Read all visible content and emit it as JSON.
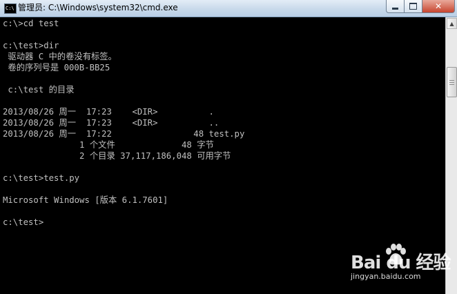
{
  "window": {
    "title": "管理员: C:\\Windows\\system32\\cmd.exe",
    "icon_label": "C:\\",
    "minimize_icon": "minimize-icon",
    "maximize_icon": "maximize-icon",
    "close_icon": "close-icon",
    "close_glyph": "✕"
  },
  "console": {
    "lines": [
      "c:\\>cd test",
      "",
      "c:\\test>dir",
      " 驱动器 C 中的卷没有标签。",
      " 卷的序列号是 000B-BB25",
      "",
      " c:\\test 的目录",
      "",
      "2013/08/26 周一  17:23    <DIR>          .",
      "2013/08/26 周一  17:23    <DIR>          ..",
      "2013/08/26 周一  17:22                48 test.py",
      "               1 个文件             48 字节",
      "               2 个目录 37,117,186,048 可用字节",
      "",
      "c:\\test>test.py",
      "",
      "Microsoft Windows [版本 6.1.7601]",
      "",
      "c:\\test>"
    ]
  },
  "scrollbar": {
    "up_arrow": "▲"
  },
  "watermark": {
    "logo_text": "Bai  du 经验",
    "url": "jingyan.baidu.com"
  }
}
